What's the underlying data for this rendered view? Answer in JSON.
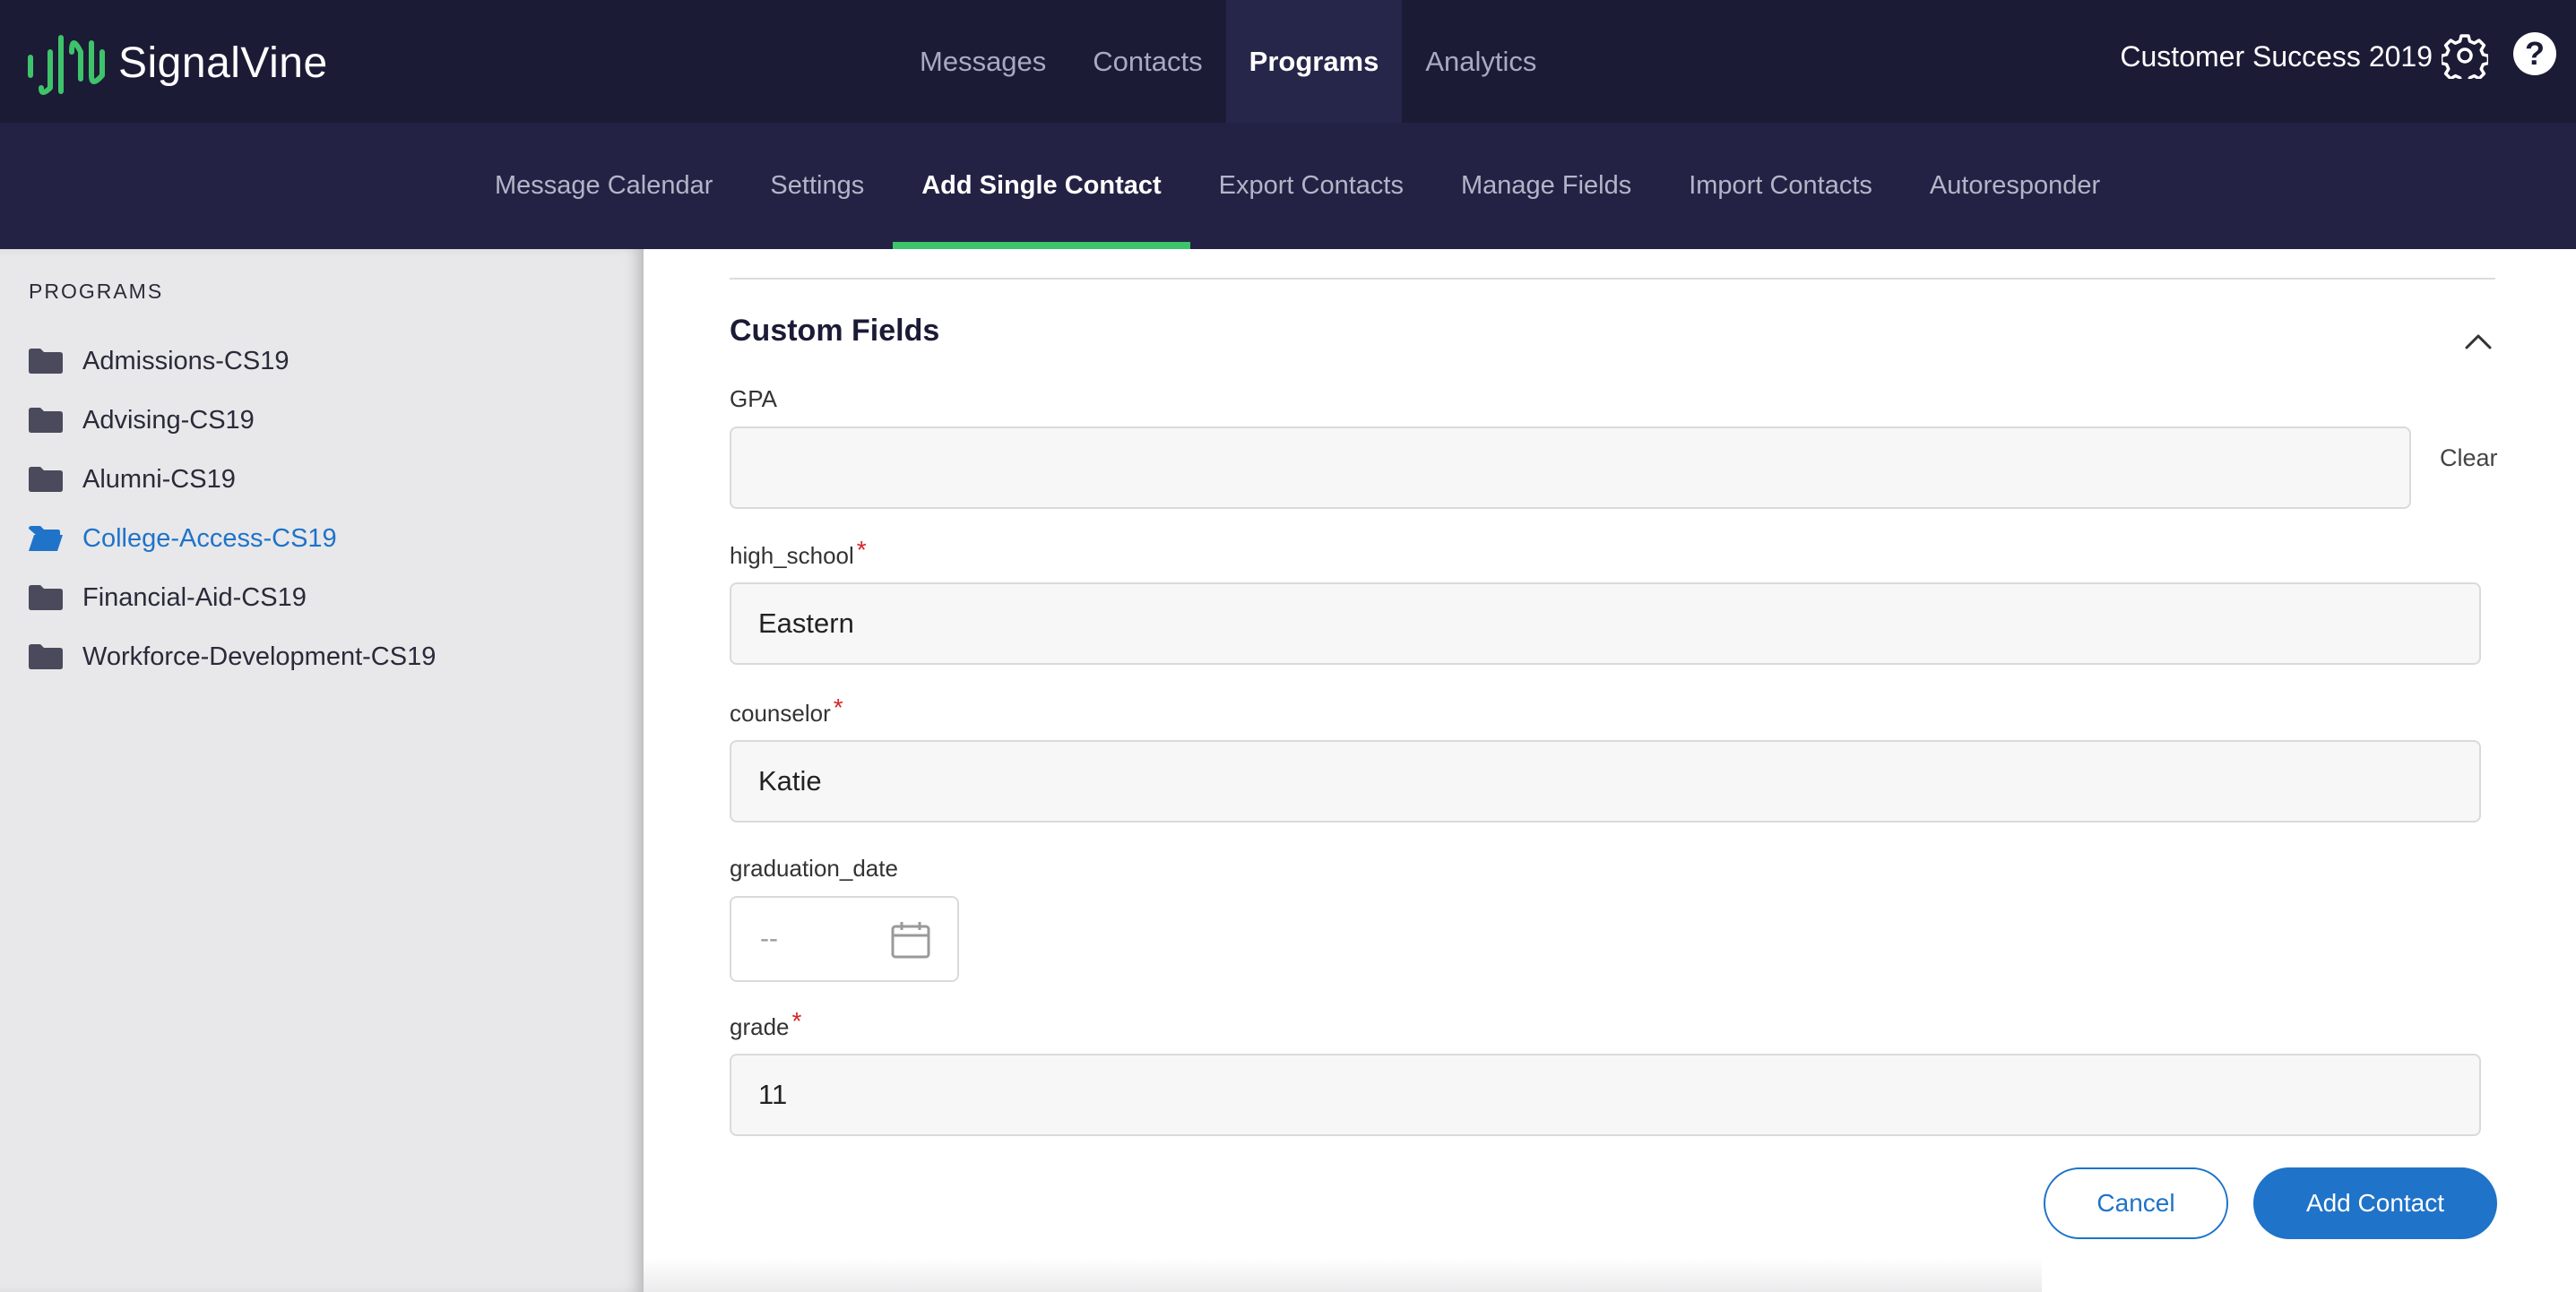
{
  "brand": {
    "name": "SignalVine",
    "accent": "#3ec36a",
    "primary": "#1f73c9",
    "navbar_bg": "#1c1b36"
  },
  "main_nav": [
    {
      "label": "Messages",
      "active": false
    },
    {
      "label": "Contacts",
      "active": false
    },
    {
      "label": "Programs",
      "active": true
    },
    {
      "label": "Analytics",
      "active": false
    }
  ],
  "account": {
    "name": "Customer Success 2019",
    "settings_icon": "gear-icon",
    "help_icon": "question-icon"
  },
  "sub_nav": [
    {
      "label": "Message Calendar",
      "active": false
    },
    {
      "label": "Settings",
      "active": false
    },
    {
      "label": "Add Single Contact",
      "active": true
    },
    {
      "label": "Export Contacts",
      "active": false
    },
    {
      "label": "Manage Fields",
      "active": false
    },
    {
      "label": "Import Contacts",
      "active": false
    },
    {
      "label": "Autoresponder",
      "active": false
    }
  ],
  "sidebar": {
    "heading": "PROGRAMS",
    "items": [
      {
        "label": "Admissions-CS19",
        "active": false
      },
      {
        "label": "Advising-CS19",
        "active": false
      },
      {
        "label": "Alumni-CS19",
        "active": false
      },
      {
        "label": "College-Access-CS19",
        "active": true
      },
      {
        "label": "Financial-Aid-CS19",
        "active": false
      },
      {
        "label": "Workforce-Development-CS19",
        "active": false
      }
    ]
  },
  "form": {
    "section_title": "Custom Fields",
    "fields": {
      "gpa": {
        "label": "GPA",
        "value": "",
        "clear_label": "Clear"
      },
      "high_school": {
        "label": "high_school",
        "required_mark": "*",
        "value": "Eastern"
      },
      "counselor": {
        "label": "counselor",
        "required_mark": "*",
        "value": "Katie"
      },
      "graduation_date": {
        "label": "graduation_date",
        "value": "--"
      },
      "grade": {
        "label": "grade",
        "required_mark": "*",
        "value": "11"
      }
    },
    "actions": {
      "cancel_label": "Cancel",
      "submit_label": "Add Contact"
    }
  }
}
